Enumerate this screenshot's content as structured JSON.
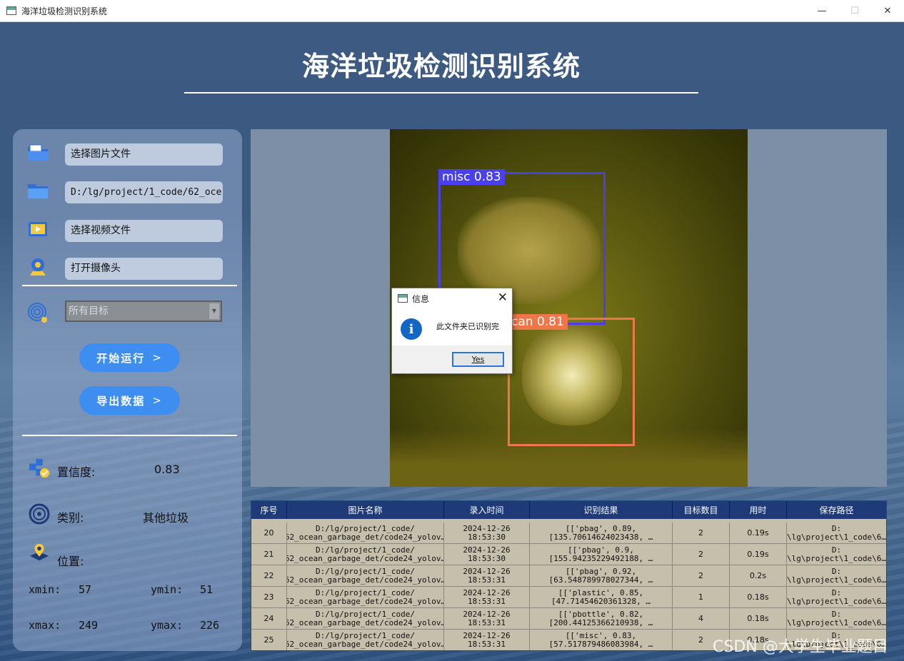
{
  "window": {
    "title": "海洋垃圾检测识别系统"
  },
  "header": {
    "title": "海洋垃圾检测识别系统"
  },
  "sidebar": {
    "select_image": "选择图片文件",
    "folder_path": "D:/lg/project/1_code/62_oce",
    "select_video": "选择视频文件",
    "open_camera": "打开摄像头",
    "target_select": "所有目标",
    "start_button": "开始运行",
    "export_button": "导出数据",
    "chevron": ">",
    "confidence_label": "置信度:",
    "confidence_value": "0.83",
    "class_label": "类别:",
    "class_value": "其他垃圾",
    "position_label": "位置:",
    "xmin_label": "xmin:",
    "xmin_value": "57",
    "ymin_label": "ymin:",
    "ymin_value": "51",
    "xmax_label": "xmax:",
    "xmax_value": "249",
    "ymax_label": "ymax:",
    "ymax_value": "226"
  },
  "detections": [
    {
      "label": "misc 0.83",
      "color": "#4a3ff0"
    },
    {
      "label": "can 0.81",
      "color": "#f0764a"
    }
  ],
  "dialog": {
    "title": "信息",
    "message": "此文件夹已识别完",
    "button": "Yes"
  },
  "table": {
    "headers": [
      "序号",
      "图片名称",
      "录入时间",
      "识别结果",
      "目标数目",
      "用时",
      "保存路径"
    ],
    "rows": [
      [
        "20",
        "D:/lg/project/1_code/\n62_ocean_garbage_det/code24_yolov…",
        "2024-12-26\n18:53:30",
        "[['pbag', 0.89,\n[135.70614624023438, …",
        "2",
        "0.19s",
        "D:\n\\lg\\project\\1_code\\6…"
      ],
      [
        "21",
        "D:/lg/project/1_code/\n62_ocean_garbage_det/code24_yolov…",
        "2024-12-26\n18:53:30",
        "[['pbag', 0.9,\n[155.94235229492188, …",
        "2",
        "0.19s",
        "D:\n\\lg\\project\\1_code\\6…"
      ],
      [
        "22",
        "D:/lg/project/1_code/\n62_ocean_garbage_det/code24_yolov…",
        "2024-12-26\n18:53:31",
        "[['pbag', 0.92,\n[63.548789978027344, …",
        "2",
        "0.2s",
        "D:\n\\lg\\project\\1_code\\6…"
      ],
      [
        "23",
        "D:/lg/project/1_code/\n62_ocean_garbage_det/code24_yolov…",
        "2024-12-26\n18:53:31",
        "[['plastic', 0.85,\n[47.71454620361328, …",
        "1",
        "0.18s",
        "D:\n\\lg\\project\\1_code\\6…"
      ],
      [
        "24",
        "D:/lg/project/1_code/\n62_ocean_garbage_det/code24_yolov…",
        "2024-12-26\n18:53:31",
        "[['pbottle', 0.82,\n[200.44125366210938, …",
        "4",
        "0.18s",
        "D:\n\\lg\\project\\1_code\\6…"
      ],
      [
        "25",
        "D:/lg/project/1_code/\n62_ocean_garbage_det/code24_yolov…",
        "2024-12-26\n18:53:31",
        "[['misc', 0.83,\n[57.517879486083984, …",
        "2",
        "0.18s",
        "D:\n\\lg\\project\\1_code\\6…"
      ]
    ]
  },
  "watermark": "CSDN @大学生毕业题目"
}
